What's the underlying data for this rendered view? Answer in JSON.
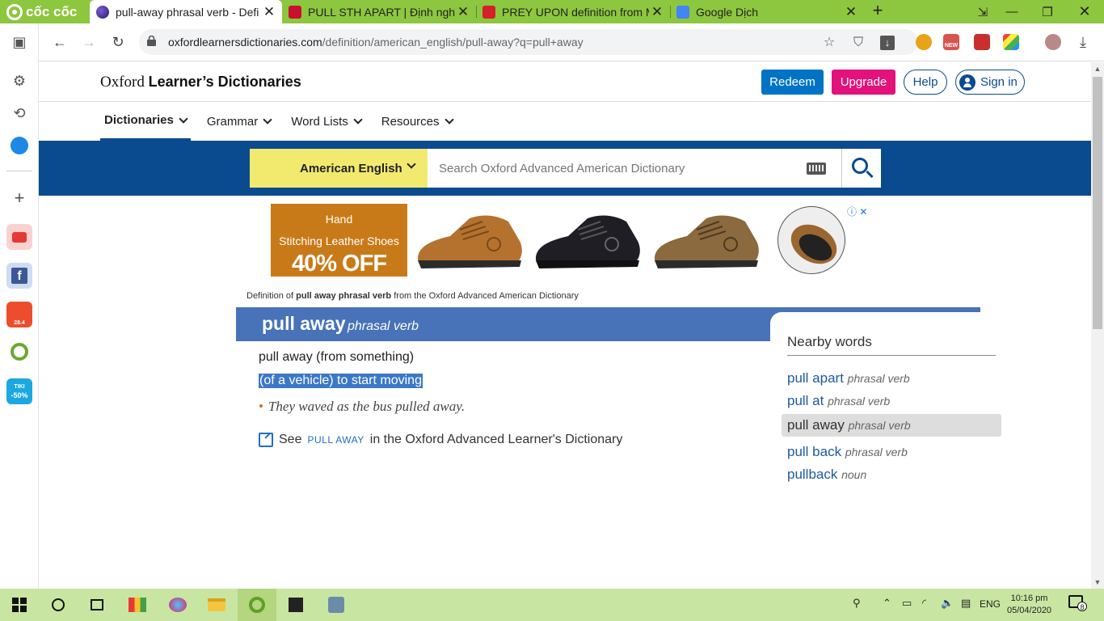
{
  "browser": {
    "brand": "cốc cốc",
    "tabs": [
      {
        "title": "pull-away phrasal verb - Defi",
        "active": true
      },
      {
        "title": "PULL STH APART | Định nghĩa",
        "active": false
      },
      {
        "title": "PREY UPON definition from M",
        "active": false
      },
      {
        "title": "Google Dịch",
        "active": false
      }
    ],
    "url_domain": "oxfordlearnersdictionaries.com",
    "url_path": "/definition/american_english/pull-away?q=pull+away",
    "ext_badge_new": "NEW"
  },
  "sidebar": {
    "tiki_label": "TIKI",
    "tiki_badge": "-50%",
    "shopee_badge": "28.4"
  },
  "site": {
    "logo_prefix": "Oxford",
    "logo_strong": "Learner’s Dictionaries",
    "buttons": {
      "redeem": "Redeem",
      "upgrade": "Upgrade",
      "help": "Help",
      "signin": "Sign in"
    },
    "nav": [
      "Dictionaries",
      "Grammar",
      "Word Lists",
      "Resources"
    ],
    "dictionary_select": "American English",
    "search_placeholder": "Search Oxford Advanced American Dictionary"
  },
  "ad": {
    "line1": "Hand",
    "line2": "Stitching Leather Shoes",
    "offer": "40% OFF"
  },
  "entry": {
    "caption_prefix": "Definition of",
    "caption_bold": "pull away phrasal verb",
    "caption_suffix": "from the Oxford Advanced American Dictionary",
    "headword": "pull away",
    "pos": "phrasal verb",
    "phrase": "pull away (from something)",
    "definition": "(of a vehicle) to start moving",
    "example": "They waved as the bus pulled away.",
    "see_prefix": "See",
    "see_link": "PULL AWAY",
    "see_suffix": "in the Oxford Advanced Learner's Dictionary"
  },
  "nearby": {
    "title": "Nearby words",
    "items": [
      {
        "word": "pull apart",
        "pos": "phrasal verb"
      },
      {
        "word": "pull at",
        "pos": "phrasal verb"
      },
      {
        "word": "pull away",
        "pos": "phrasal verb",
        "current": true
      },
      {
        "word": "pull back",
        "pos": "phrasal verb"
      },
      {
        "word": "pullback",
        "pos": "noun"
      }
    ]
  },
  "taskbar": {
    "language": "ENG",
    "time": "10:16 pm",
    "date": "05/04/2020",
    "notification_count": "8"
  },
  "colors": {
    "browser_green": "#8dc63f",
    "oxford_blue": "#0a4b8f",
    "headband": "#4873b8",
    "selector_yellow": "#f2ea6f",
    "upgrade_pink": "#e2127a"
  }
}
